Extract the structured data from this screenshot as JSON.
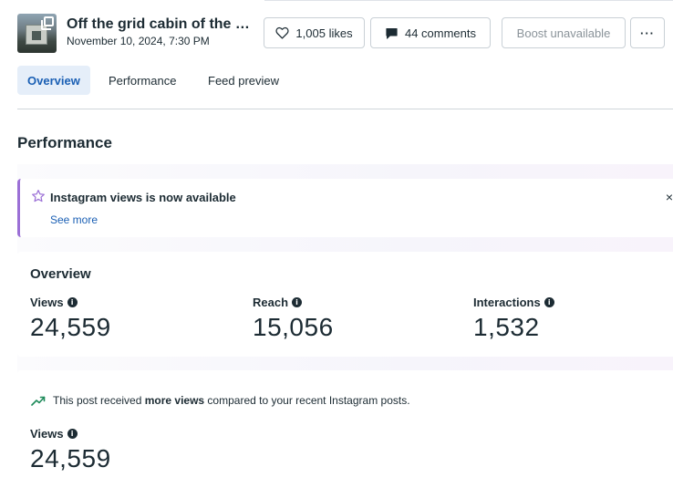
{
  "post": {
    "title": "Off the grid cabin of the dreams",
    "date": "November 10, 2024, 7:30 PM"
  },
  "actions": {
    "likes": "1,005 likes",
    "comments": "44 comments",
    "boost": "Boost unavailable",
    "more": "···"
  },
  "tabs": [
    {
      "label": "Overview",
      "active": true
    },
    {
      "label": "Performance",
      "active": false
    },
    {
      "label": "Feed preview",
      "active": false
    }
  ],
  "section_title": "Performance",
  "notice": {
    "text": "Instagram views is now available",
    "link": "See more",
    "close": "×"
  },
  "overview": {
    "title": "Overview",
    "metrics": [
      {
        "label": "Views",
        "value": "24,559"
      },
      {
        "label": "Reach",
        "value": "15,056"
      },
      {
        "label": "Interactions",
        "value": "1,532"
      }
    ]
  },
  "insight": {
    "prefix": "This post received ",
    "emphasis": "more views",
    "suffix": " compared to your recent Instagram posts.",
    "metric_label": "Views",
    "metric_value": "24,559"
  },
  "colors": {
    "accent": "#1a5fb4",
    "notice_border": "#9b6fd6",
    "trend": "#1e8a5a"
  },
  "icons": {
    "likes": "heart-icon",
    "comments": "comment-icon",
    "notice": "star-icon",
    "info": "info-icon",
    "trend": "trend-up-icon"
  }
}
